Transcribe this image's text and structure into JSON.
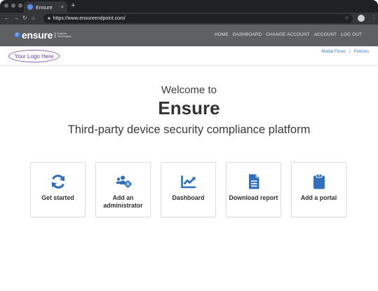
{
  "browser": {
    "tab_title": "Ensure",
    "tab_close": "×",
    "new_tab": "+",
    "url": "https://www.ensureendpoint.com/"
  },
  "site": {
    "logo_text": "ensure",
    "logo_subtext": "Endpoint Technologies",
    "nav": [
      "HOME",
      "DASHBOARD",
      "CHANGE ACCOUNT",
      "ACCOUNT",
      "LOG OUT"
    ],
    "client_logo": "Your Logo Here",
    "sublinks": [
      "Modal Flows",
      "Policies"
    ],
    "sublink_separator": "|"
  },
  "hero": {
    "welcome": "Welcome to",
    "brand": "Ensure",
    "tagline": "Third-party device security compliance platform"
  },
  "cards": [
    {
      "label": "Get started",
      "icon": "refresh-icon"
    },
    {
      "label": "Add an administrator",
      "icon": "users-gear-icon"
    },
    {
      "label": "Dashboard",
      "icon": "chart-line-icon"
    },
    {
      "label": "Download report",
      "icon": "document-icon"
    },
    {
      "label": "Add a portal",
      "icon": "clipboard-icon"
    }
  ],
  "colors": {
    "accent": "#2f6fbe",
    "header_bg": "#5f6062",
    "chrome_bg": "#202124"
  }
}
